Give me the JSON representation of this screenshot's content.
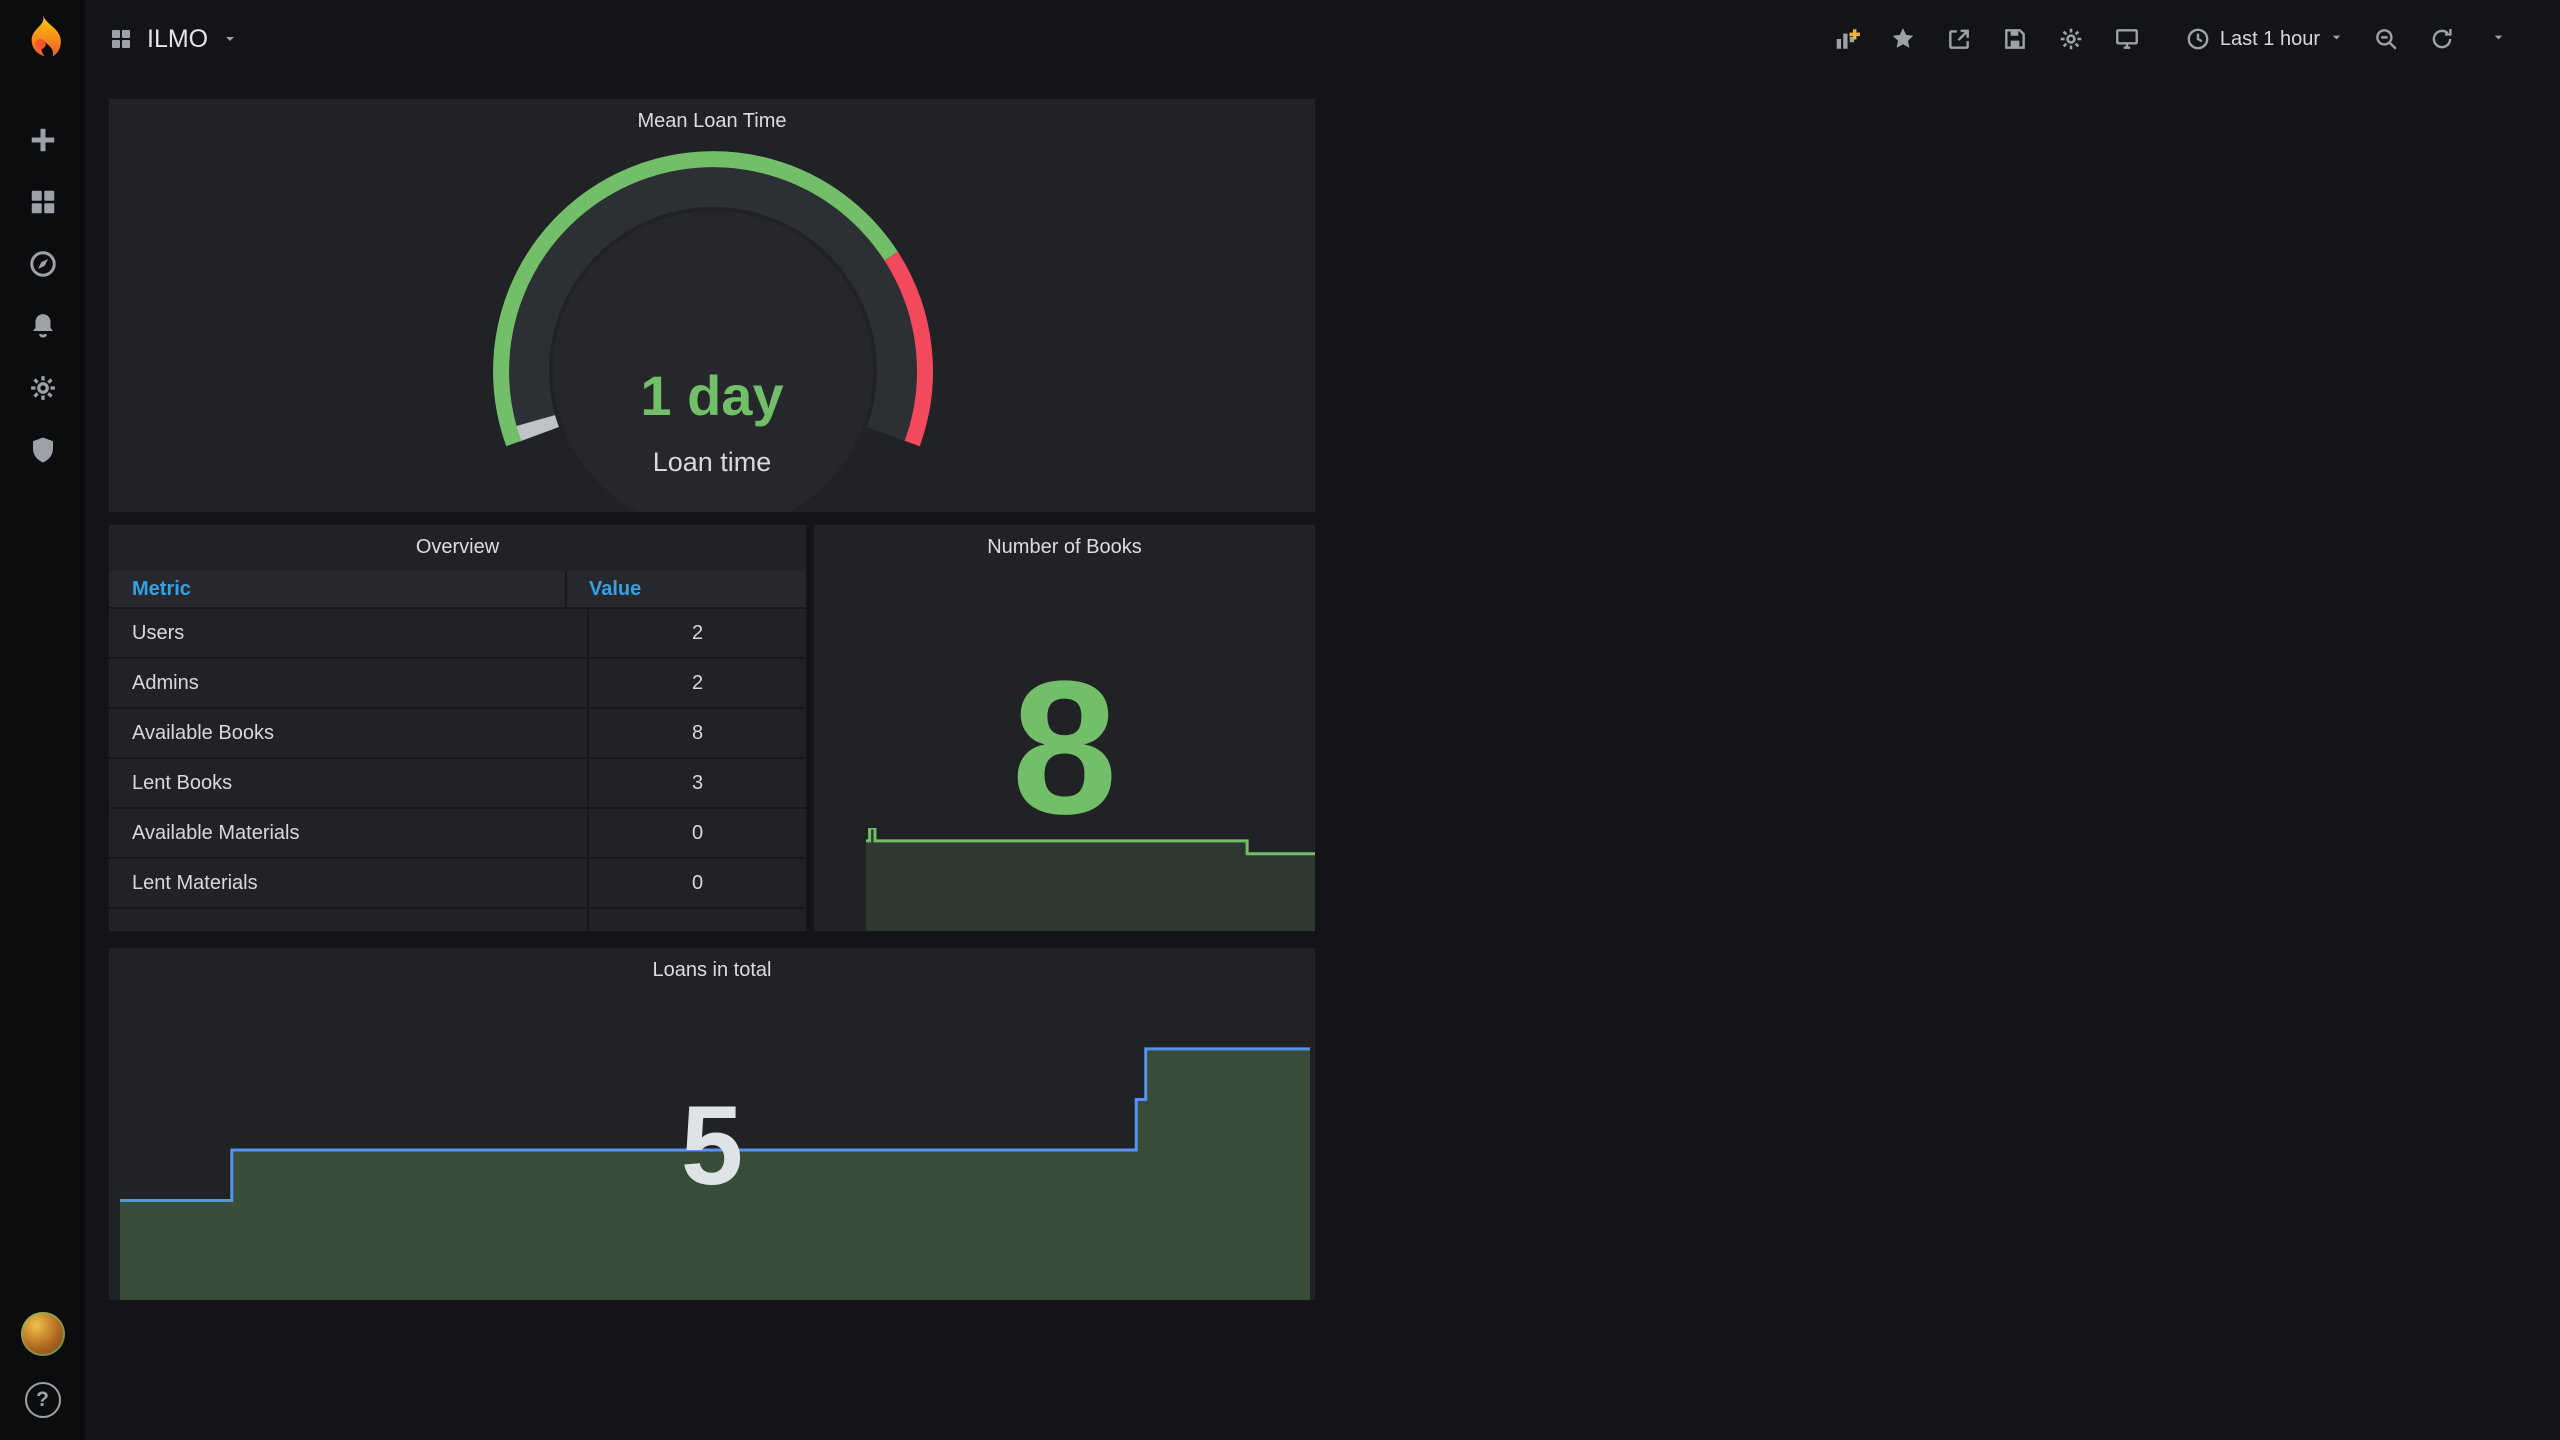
{
  "navbar": {
    "dashboard_title": "ILMO",
    "time_range": {
      "label": "Last 1 hour",
      "icon": "clock-icon"
    },
    "icons": [
      "dashboard-squares-icon",
      "add-panel-icon",
      "star-icon",
      "share-icon",
      "save-icon",
      "settings-gear-icon",
      "cycle-view-monitor-icon",
      "clock-icon",
      "zoom-out-icon",
      "refresh-icon",
      "refresh-interval-caret-icon"
    ]
  },
  "sidebar": {
    "icons": [
      "grafana-logo",
      "create-plus-icon",
      "dashboards-icon",
      "explore-compass-icon",
      "alerting-bell-icon",
      "configuration-gear-icon",
      "server-admin-shield-icon",
      "user-avatar",
      "help-icon"
    ],
    "help_glyph": "?"
  },
  "panels": {
    "mean_loan_time": {
      "title": "Mean Loan Time",
      "value_text": "1 day",
      "label": "Loan time"
    },
    "overview": {
      "title": "Overview",
      "columns": [
        "Metric",
        "Value"
      ],
      "rows": [
        {
          "metric": "Users",
          "value": "2"
        },
        {
          "metric": "Admins",
          "value": "2"
        },
        {
          "metric": "Available Books",
          "value": "8"
        },
        {
          "metric": "Lent Books",
          "value": "3"
        },
        {
          "metric": "Available Materials",
          "value": "0"
        },
        {
          "metric": "Lent Materials",
          "value": "0"
        }
      ]
    },
    "number_of_books": {
      "title": "Number of Books",
      "value": "8"
    },
    "loans_in_total": {
      "title": "Loans in total",
      "value": "5"
    }
  },
  "colors": {
    "green": "#73BF69",
    "red": "#F2495C",
    "blue_line": "#5794F2",
    "link_blue": "#33A2E5",
    "panel_bg": "#202226",
    "page_bg": "#131417",
    "sidebar_bg": "#0b0c0e",
    "add_panel_plus": "#F2B13D"
  },
  "chart_data": [
    {
      "type": "gauge",
      "panel": "Mean Loan Time",
      "value_text": "1 day",
      "label": "Loan time",
      "value_percent": 0.76,
      "start_angle_deg": 200,
      "end_angle_deg": -20,
      "segments": [
        {
          "from": 0,
          "to": 0.76,
          "color": "#73BF69"
        },
        {
          "from": 0.76,
          "to": 1,
          "color": "#F2495C"
        }
      ]
    },
    {
      "type": "area",
      "panel": "Number of Books",
      "stat_value": 8,
      "step": true,
      "x": [
        0,
        0.008,
        0.02,
        0.83,
        0.845,
        1
      ],
      "y": [
        9,
        10,
        9,
        9,
        8,
        8
      ],
      "ymin": 2,
      "ymax": 10,
      "line_color": "#73BF69",
      "line_width": 3,
      "fill_color": "rgba(115,191,105,0.15)"
    },
    {
      "type": "area",
      "panel": "Loans in total",
      "stat_value": 5,
      "step": true,
      "x": [
        0,
        0.094,
        0.854,
        0.862,
        1
      ],
      "y": [
        2,
        3,
        4,
        5,
        5
      ],
      "ymin": 0,
      "ymax": 7,
      "line_color": "#5794F2",
      "line_width": 3,
      "fill_color": "rgba(115,191,105,0.28)"
    }
  ]
}
